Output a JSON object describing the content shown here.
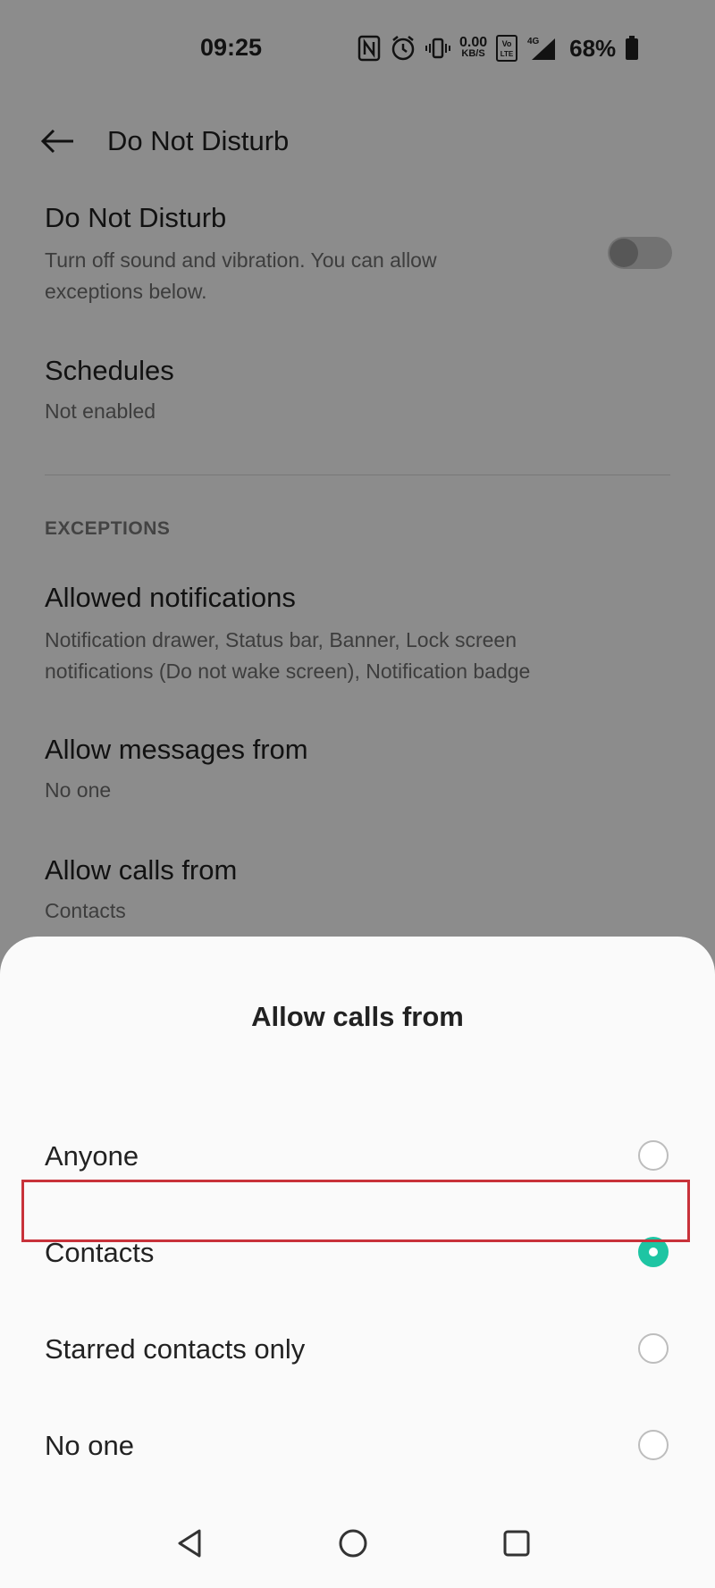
{
  "status_bar": {
    "time": "09:25",
    "speed_value": "0.00",
    "speed_unit": "KB/S",
    "network": "4G",
    "volte": "Vo LTE",
    "battery": "68%"
  },
  "app_bar": {
    "title": "Do Not Disturb"
  },
  "settings": {
    "dnd": {
      "title": "Do Not Disturb",
      "subtitle": "Turn off sound and vibration. You can allow exceptions below.",
      "enabled": false
    },
    "schedules": {
      "title": "Schedules",
      "subtitle": "Not enabled"
    },
    "exceptions_header": "EXCEPTIONS",
    "allowed_notifications": {
      "title": "Allowed notifications",
      "subtitle": "Notification drawer, Status bar, Banner, Lock screen notifications (Do not wake screen), Notification badge"
    },
    "allow_messages": {
      "title": "Allow messages from",
      "subtitle": "No one"
    },
    "allow_calls": {
      "title": "Allow calls from",
      "subtitle": "Contacts"
    }
  },
  "sheet": {
    "title": "Allow calls from",
    "options": [
      {
        "label": "Anyone",
        "selected": false
      },
      {
        "label": "Contacts",
        "selected": true
      },
      {
        "label": "Starred contacts only",
        "selected": false
      },
      {
        "label": "No one",
        "selected": false
      }
    ]
  },
  "colors": {
    "accent": "#1ec5a3",
    "highlight": "#c8323a"
  },
  "icons": {
    "back": "arrow-left",
    "nav_back": "triangle-left",
    "nav_home": "circle",
    "nav_recents": "square"
  }
}
